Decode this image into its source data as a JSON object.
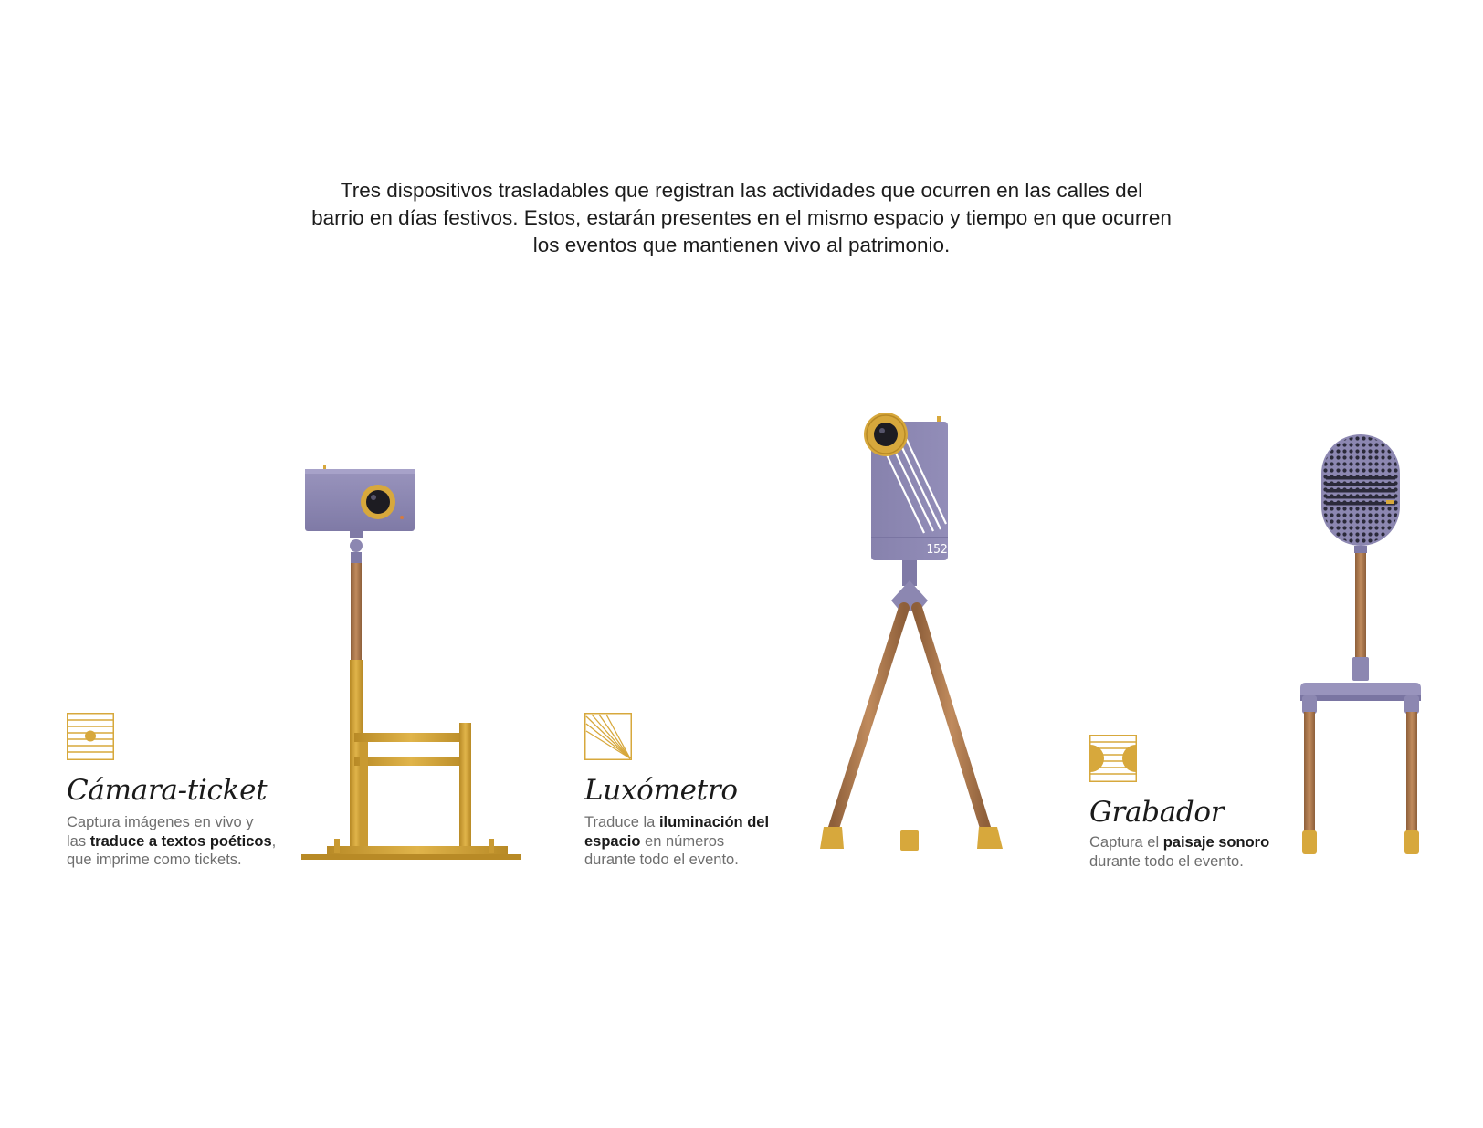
{
  "intro": {
    "line1": "Tres dispositivos trasladables que registran las actividades que ocurren en las calles del",
    "line2": "barrio en días festivos. Estos, estarán presentes en el mismo espacio y tiempo en que ocurren",
    "line3": "los eventos que mantienen vivo al patrimonio."
  },
  "devices": [
    {
      "title": "Cámara-ticket",
      "icon": "sun-horizon-icon",
      "desc": {
        "l1": "Captura imágenes en vivo y",
        "l2a": "las ",
        "l2b": "traduce a textos poéticos",
        "l2c": ",",
        "l3": "que imprime como tickets."
      }
    },
    {
      "title": "Luxómetro",
      "icon": "light-rays-icon",
      "readout": "152",
      "desc": {
        "l1a": "Traduce la ",
        "l1b": "iluminación del",
        "l2a": "espacio",
        "l2b": " en números",
        "l3": "durante todo el evento."
      }
    },
    {
      "title": "Grabador",
      "icon": "sound-half-circles-icon",
      "desc": {
        "l1a": "Captura el ",
        "l1b": "paisaje sonoro",
        "l2": "durante todo el evento."
      }
    }
  ],
  "colors": {
    "lavender": "#8c87b1",
    "lavender_dark": "#6c6794",
    "mustard": "#d7a83c",
    "mustard_dark": "#b88a26",
    "wood": "#b57e52",
    "wood_dark": "#8e5f3a"
  }
}
